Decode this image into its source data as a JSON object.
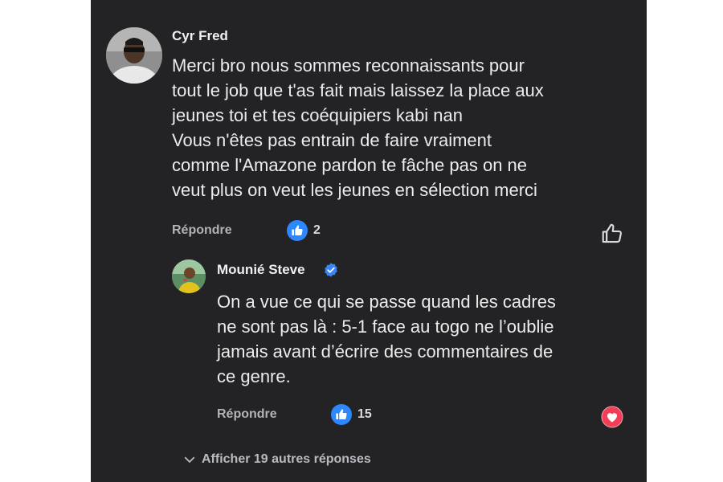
{
  "comment": {
    "author": "Cyr Fred",
    "lines": [
      "Merci bro nous sommes reconnaissants pour",
      "tout le job que t'as fait mais laissez la place aux",
      "jeunes toi et tes coéquipiers kabi nan",
      "Vous n'êtes pas entrain de faire vraiment",
      "comme l'Amazone pardon te fâche pas on ne",
      "veut plus on veut les jeunes en sélection merci"
    ],
    "reply_label": "Répondre",
    "like_count": "2",
    "reaction_icon": "thumbs-up-icon",
    "action_icon": "like-outline-icon"
  },
  "reply": {
    "author": "Mounié Steve",
    "verified_icon": "verified-badge-icon",
    "lines": [
      "On a vue ce qui se passe quand les cadres",
      "ne sont pas là : 5-1 face au togo ne l’oublie",
      "jamais avant d’écrire des commentaires de",
      "ce genre."
    ],
    "reply_label": "Répondre",
    "like_count": "15",
    "reaction_icon": "thumbs-up-icon",
    "action_icon": "heart-icon"
  },
  "more_replies": {
    "label": "Afficher 19 autres réponses",
    "icon": "chevron-down-icon"
  },
  "colors": {
    "background": "#232326",
    "like_blue": "#2d88ff",
    "verified_blue": "#3a84f5",
    "heart_red": "#f33e58",
    "secondary_text": "#b0b3b8"
  }
}
